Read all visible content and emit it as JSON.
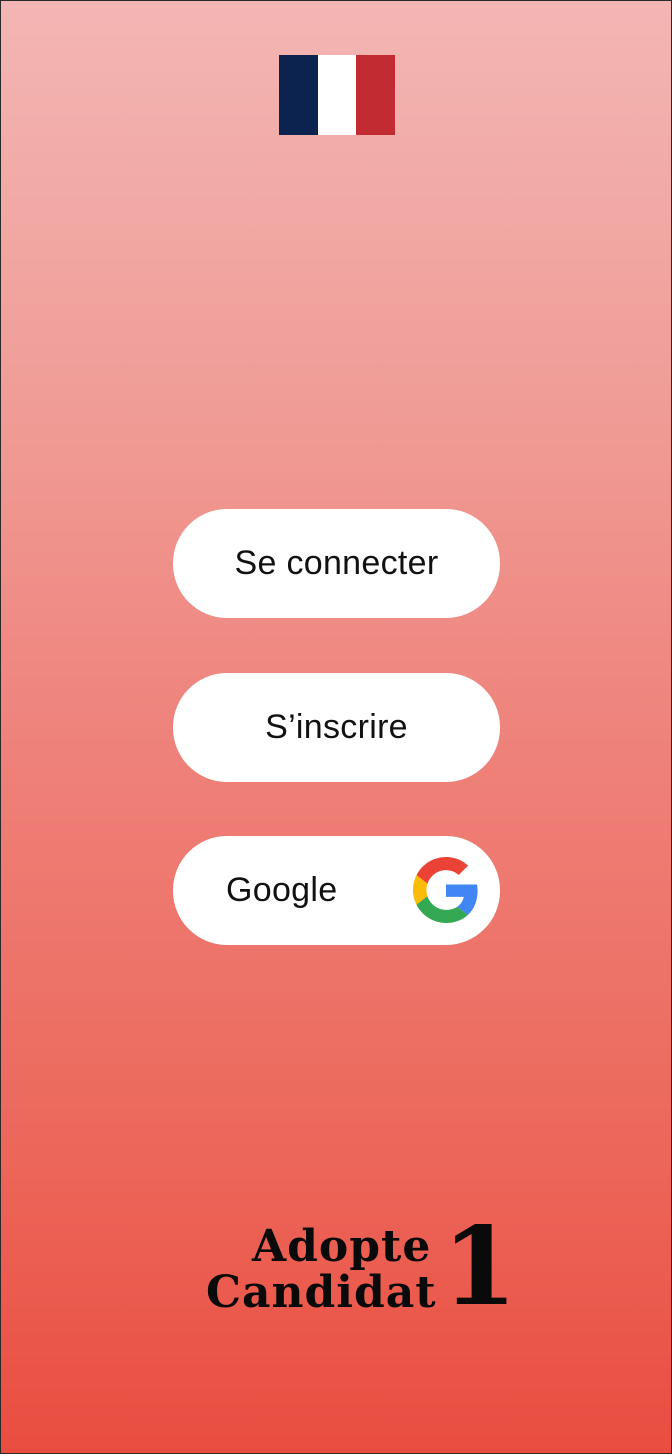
{
  "language": {
    "current": "fr",
    "flag_colors": [
      "#0c2350",
      "#ffffff",
      "#c32b33"
    ]
  },
  "auth": {
    "login_label": "Se connecter",
    "signup_label": "S’inscrire",
    "google_label": "Google",
    "google_icon": "google-g-icon"
  },
  "brand": {
    "line1": "Adopte",
    "line2": "Candidat",
    "number": "1"
  },
  "colors": {
    "gradient_top": "#f3b6b4",
    "gradient_bottom": "#e94d40",
    "button_bg": "#ffffff",
    "text": "#111111"
  }
}
